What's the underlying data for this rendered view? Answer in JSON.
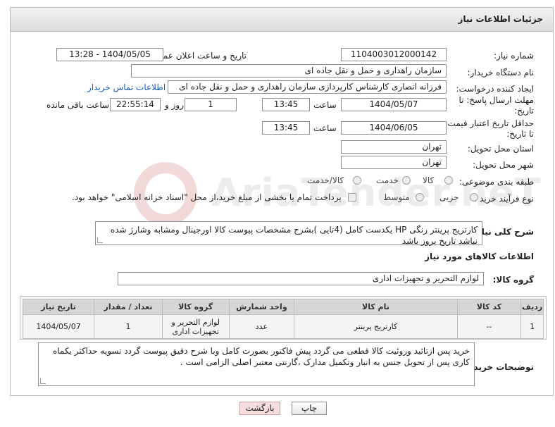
{
  "header": {
    "title": "جزئیات اطلاعات نیاز"
  },
  "fields": {
    "need_number_label": "شماره نیاز:",
    "need_number": "1104003012000142",
    "announce_label": "تاریخ و ساعت اعلان عمومی:",
    "announce_value": "1404/05/05 - 13:28",
    "buyer_org_label": "نام دستگاه خریدار:",
    "buyer_org": "سازمان راهداری و حمل و نقل جاده ای",
    "requester_label": "ایجاد کننده درخواست:",
    "requester": "فرزانه انصاری کارشناس کارپردازی سازمان راهداری و حمل و نقل جاده ای",
    "contact_link": "اطلاعات تماس خریدار",
    "deadline_label_1": "مهلت ارسال پاسخ: تا",
    "deadline_label_2": "تاریخ:",
    "deadline_date": "1404/05/07",
    "time_label": "ساعت",
    "deadline_time": "13:45",
    "days_value": "1",
    "days_label": "روز و",
    "remaining_time": "22:55:14",
    "remaining_label": "ساعت باقی مانده",
    "price_label_1": "حداقل تاریخ اعتبار قیمت:",
    "price_label_2": "تا تاریخ:",
    "price_date": "1404/06/05",
    "price_time": "13:45",
    "province_label": "استان محل تحویل:",
    "province": "تهران",
    "city_label": "شهر محل تحویل:",
    "city": "تهران",
    "category_label": "طبقه بندی موضوعی:",
    "category_options": [
      "کالا",
      "خدمت",
      "کالا/خدمت"
    ],
    "process_label": "نوع فرآیند خرید :",
    "process_options": [
      "جزیی",
      "متوسط"
    ],
    "payment_note": "پرداخت تمام یا بخشی از مبلغ خرید،از محل \"اسناد خزانه اسلامی\" خواهد بود."
  },
  "description": {
    "label": "شرح کلی نیاز:",
    "text": "کارتریج پرینتر رنگی HP یکدست کامل (4تایی )بشرح مشخصات پیوست کالا اورجینال ومشابه وشارژ شده نباشد تاریخ بروز باشد"
  },
  "goods_info": {
    "title": "اطلاعات کالاهای مورد نیاز",
    "group_label": "گروه کالا:",
    "group_value": "لوازم التحریر و تجهیزات اداری"
  },
  "table": {
    "headers": [
      "ردیف",
      "کد کالا",
      "نام کالا",
      "واحد شمارش",
      "گروه کالا",
      "تعداد / مقدار",
      "تاریخ نیاز"
    ],
    "rows": [
      [
        "1",
        "--",
        "کارتریج پرینتر",
        "عدد",
        "لوازم التحریر و تجهیزات اداری",
        "1",
        "1404/05/07"
      ]
    ]
  },
  "buyer_notes": {
    "label": "توضیحات خریدار:",
    "text": "خرید پس ازتائید وروئیت کالا قطعی می گردد پیش فاکتور بصورت کامل وبا شرح دقیق پیوست گردد تسویه حداکثر یکماه کاری پس از تحویل جنس به انبار وتکمیل مدارک ،گارنتی معتبر اصلی الزامی است ."
  },
  "buttons": {
    "print": "چاپ",
    "back": "بازگشت"
  },
  "watermark": {
    "text": "AriaTender.neT"
  },
  "colors": {
    "link": "#1a5fb4",
    "back_button": "#f7dede",
    "header_bg": "#dcdcdc"
  }
}
